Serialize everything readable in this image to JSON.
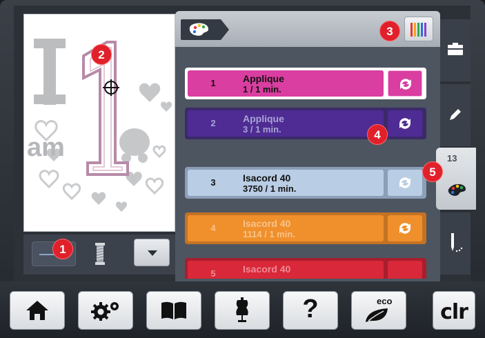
{
  "color_rows": [
    {
      "num": "1",
      "line1": "Applique",
      "line2": "1 / 1 min."
    },
    {
      "num": "2",
      "line1": "Applique",
      "line2": "3 / 1 min."
    },
    {
      "num": "3",
      "line1": "Isacord 40",
      "line2": "3750 / 1 min."
    },
    {
      "num": "4",
      "line1": "Isacord 40",
      "line2": "1114 / 1 min."
    },
    {
      "num": "5",
      "line1": "Isacord 40",
      "line2": ""
    }
  ],
  "sidebar": {
    "color_count": "13"
  },
  "callouts": [
    "1",
    "2",
    "3",
    "4",
    "5"
  ],
  "bottom_bar": {
    "help_label": "?",
    "eco_label": "eco",
    "clr_label": "clr"
  },
  "design": {
    "text_i": "I",
    "text_am": "am"
  },
  "colors": {
    "row1": "#d93ea0",
    "row2": "#4e2c93",
    "row3": "#b9cde4",
    "row4": "#f0902c",
    "row5": "#d8283a",
    "callout": "#e0202a"
  }
}
